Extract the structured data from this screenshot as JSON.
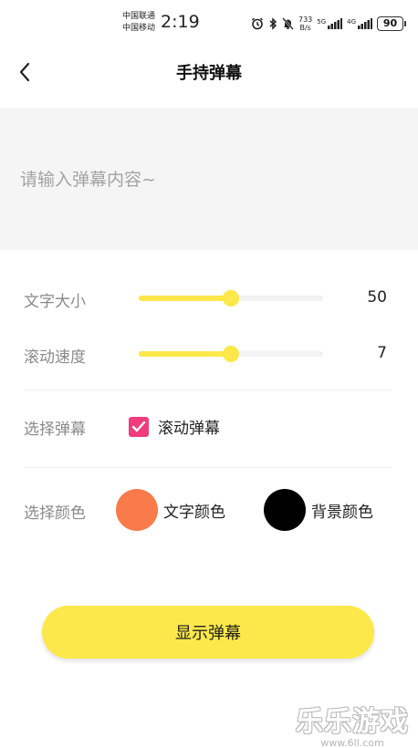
{
  "status_bar": {
    "carrier_1": "中国联通",
    "carrier_2": "中国移动",
    "time": "2:19",
    "net_speed_value": "733",
    "net_speed_unit": "B/s",
    "signal_1_label": "5G",
    "signal_2_label": "4G",
    "battery": "90",
    "icons": [
      "alarm-icon",
      "bluetooth-icon",
      "mute-icon",
      "signal-icon",
      "battery-icon"
    ]
  },
  "header": {
    "title": "手持弹幕",
    "back_icon": "chevron-left-icon"
  },
  "input": {
    "placeholder": "请输入弹幕内容~",
    "value": ""
  },
  "settings": {
    "font_size": {
      "label": "文字大小",
      "value": "50",
      "percent": 50
    },
    "scroll_speed": {
      "label": "滚动速度",
      "value": "7",
      "percent": 50
    },
    "mode": {
      "label": "选择弹幕",
      "option_label": "滚动弹幕",
      "checked": true
    },
    "color": {
      "label": "选择颜色",
      "text_color_label": "文字颜色",
      "text_color": "#f97a4b",
      "bg_color_label": "背景颜色",
      "bg_color": "#000000"
    }
  },
  "actions": {
    "show_label": "显示弹幕"
  },
  "theme": {
    "accent": "#fce84a",
    "checkbox": "#ee3d7a"
  },
  "watermark": {
    "text": "乐乐游戏",
    "url": "www.6ll.com"
  }
}
